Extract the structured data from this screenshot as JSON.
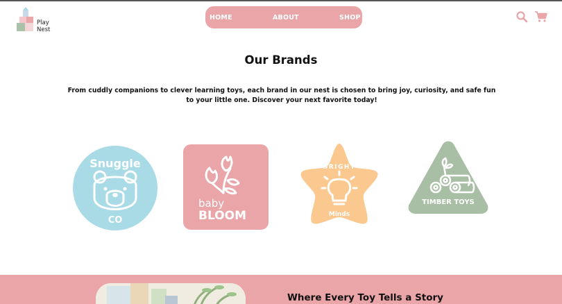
{
  "header": {
    "logo_text_line1": "Play",
    "logo_text_line2": "Nest",
    "nav": [
      {
        "label": "HOME"
      },
      {
        "label": "ABOUT"
      },
      {
        "label": "SHOP"
      }
    ],
    "icons": [
      "search-icon",
      "cart-icon"
    ]
  },
  "main": {
    "title": "Our Brands",
    "intro": "From cuddly companions to clever learning toys, each brand in our nest is chosen to bring joy, curiosity, and safe fun to your little one. Discover your next favorite today!",
    "brands": [
      {
        "name": "Snuggle",
        "sub": "CO",
        "shape": "circle",
        "color": "#a9dbe6"
      },
      {
        "name": "BLOOM",
        "sub": "baby",
        "shape": "rounded-square",
        "color": "#e9a5a8"
      },
      {
        "name": "Minds",
        "sub": "BRIGHT",
        "shape": "star",
        "color": "#fbc98f"
      },
      {
        "name": "TIMBER TOYS",
        "sub": "",
        "shape": "triangle",
        "color": "#a9bfa5"
      }
    ]
  },
  "story": {
    "title": "Where Every Toy Tells a Story"
  },
  "colors": {
    "accent_pink": "#e9a5a8",
    "snuggle_blue": "#a9dbe6",
    "bright_orange": "#fbc98f",
    "timber_green": "#a9bfa5"
  }
}
